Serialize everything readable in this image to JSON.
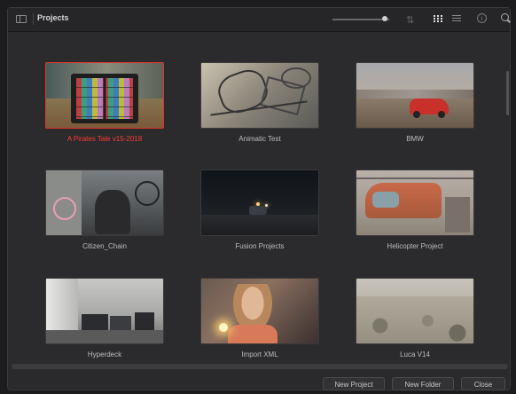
{
  "window": {
    "title": "Projects"
  },
  "toolbar": {
    "zoom_slider_level": 0.85,
    "icons": [
      "sidebar-toggle-icon",
      "sort-icon",
      "grid-view-icon",
      "list-view-icon",
      "info-icon",
      "search-icon"
    ]
  },
  "projects": [
    {
      "name": "A Pirates Tale v15-2018",
      "selected": true,
      "thumb": "color-chart-outdoors"
    },
    {
      "name": "Animatic Test",
      "selected": false,
      "thumb": "sketch-drawing"
    },
    {
      "name": "BMW",
      "selected": false,
      "thumb": "red-car-desert"
    },
    {
      "name": "Citizen_Chain",
      "selected": false,
      "thumb": "bicycle-workshop"
    },
    {
      "name": "Fusion Projects",
      "selected": false,
      "thumb": "night-road"
    },
    {
      "name": "Helicopter Project",
      "selected": false,
      "thumb": "helicopter"
    },
    {
      "name": "Hyperdeck",
      "selected": false,
      "thumb": "office-interior"
    },
    {
      "name": "Import XML",
      "selected": false,
      "thumb": "woman-sparkler"
    },
    {
      "name": "Luca V14",
      "selected": false,
      "thumb": "desert-landscape"
    }
  ],
  "footer": {
    "new_project": "New Project",
    "new_folder": "New Folder",
    "close": "Close"
  },
  "colors": {
    "selection": "#e0332e",
    "background": "#2b2b2e"
  }
}
